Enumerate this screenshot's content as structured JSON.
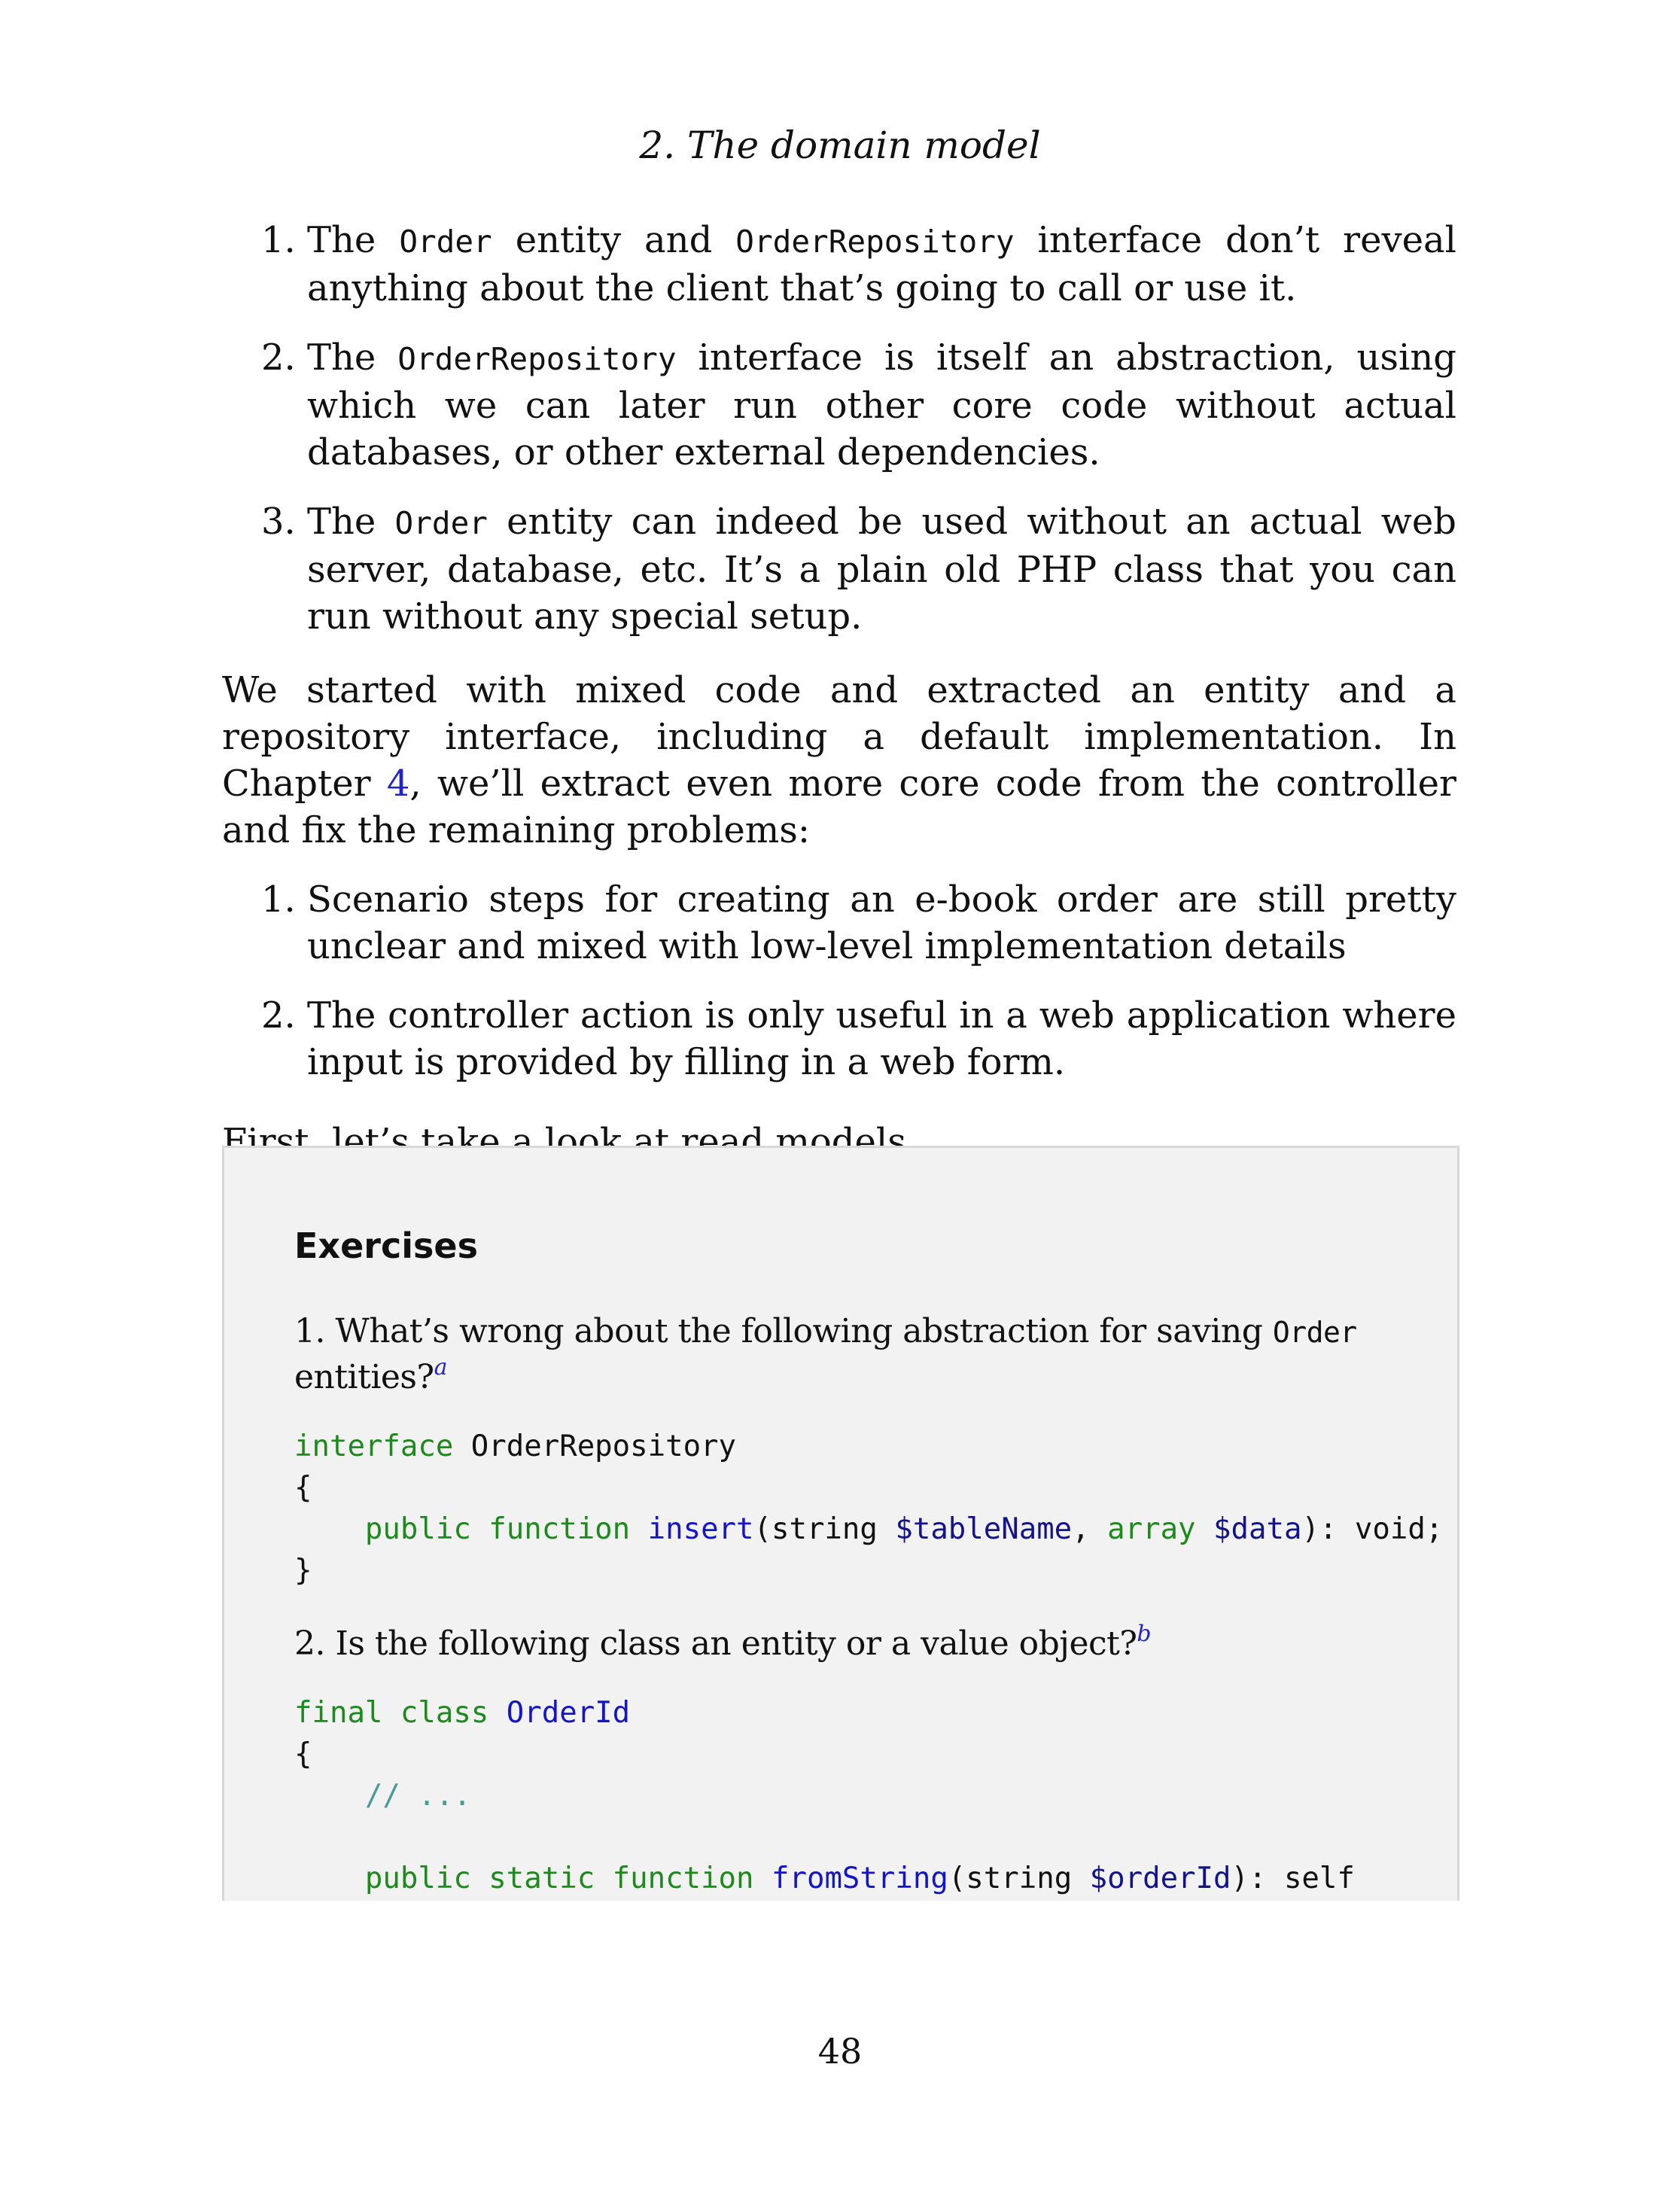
{
  "running_head": "2. The domain model",
  "list1": [
    {
      "num": "1.",
      "t1": "The ",
      "c1": "Order",
      "t2": " entity and ",
      "c2": "OrderRepository",
      "t3": " interface don’t reveal anything about the client that’s going to call or use it."
    },
    {
      "num": "2.",
      "t1": "The ",
      "c1": "OrderRepository",
      "t2": " interface is itself an abstraction, using which we can later run other core code without actual databases, or other external dependencies."
    },
    {
      "num": "3.",
      "t1": "The ",
      "c1": "Order",
      "t2": " entity can indeed be used without an actual web server, database, etc. It’s a plain old PHP class that you can run without any special setup."
    }
  ],
  "paragraph1": {
    "before": "We started with mixed code and extracted an entity and a repository interface, including a default implementation. In Chapter ",
    "link": "4",
    "after": ", we’ll extract even more core code from the controller and fix the remaining problems:"
  },
  "list2": [
    {
      "num": "1.",
      "text": "Scenario steps for creating an e-book order are still pretty unclear and mixed with low-level implementation details"
    },
    {
      "num": "2.",
      "text": "The controller action is only useful in a web application where input is provided by filling in a web form."
    }
  ],
  "paragraph2": "First, let’s take a look at read models.",
  "exercises": {
    "title": "Exercises",
    "q1": {
      "text": "1. What’s wrong about the following abstraction for saving ",
      "code": "Order",
      "after": " entities?",
      "footnote": "a"
    },
    "code1": {
      "l1_kw": "interface",
      "l1_name": " OrderRepository",
      "l2": "{",
      "l3_indent": "    ",
      "l3_kw1": "public",
      "l3_kw2": "function",
      "l3_fn": "insert",
      "l3_p1": "(string ",
      "l3_v1": "$tableName",
      "l3_p2": ", ",
      "l3_kw3": "array",
      "l3_v2": "$data",
      "l3_p3": "): void;",
      "l4": "}"
    },
    "q2": {
      "text": "2. Is the following class an entity or a value object?",
      "footnote": "b"
    },
    "code2": {
      "l1_kw1": "final",
      "l1_kw2": "class",
      "l1_fn": "OrderId",
      "l2": "{",
      "l3_indent": "    ",
      "l3_cmt": "// ...",
      "l5_indent": "    ",
      "l5_kw1": "public",
      "l5_kw2": "static",
      "l5_kw3": "function",
      "l5_fn": "fromString",
      "l5_p1": "(string ",
      "l5_v1": "$orderId",
      "l5_p2": "): self"
    }
  },
  "page_number": "48"
}
